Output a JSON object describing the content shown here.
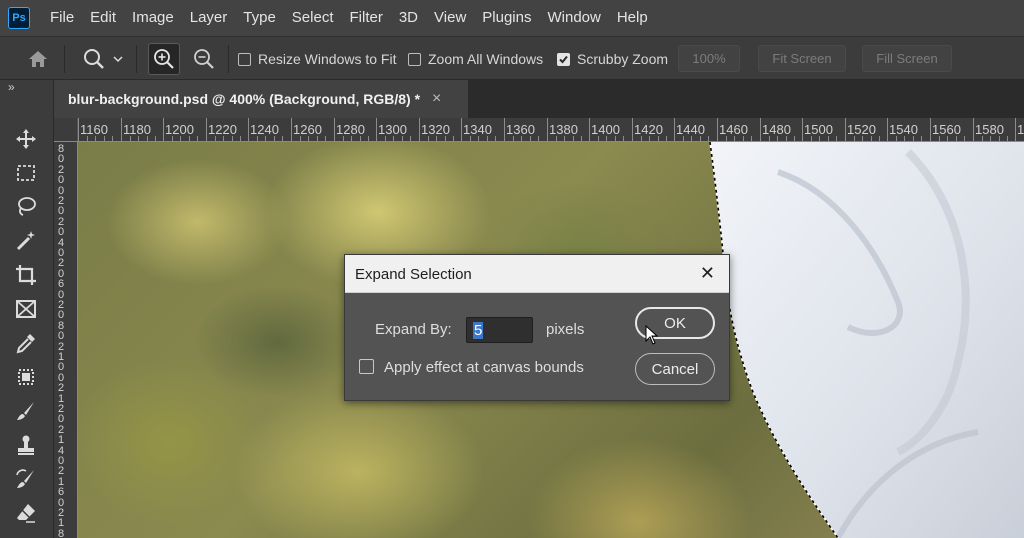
{
  "app": {
    "logo": "Ps"
  },
  "menu": [
    "File",
    "Edit",
    "Image",
    "Layer",
    "Type",
    "Select",
    "Filter",
    "3D",
    "View",
    "Plugins",
    "Window",
    "Help"
  ],
  "options": {
    "resize_windows_label": "Resize Windows to Fit",
    "zoom_all_label": "Zoom All Windows",
    "scrubby_zoom_label": "Scrubby Zoom",
    "zoom_percent": "100%",
    "fit_screen": "Fit Screen",
    "fill_screen": "Fill Screen",
    "resize_windows_checked": false,
    "zoom_all_checked": false,
    "scrubby_zoom_checked": true
  },
  "toolbar": {
    "collapse": "»"
  },
  "document": {
    "tab_title": "blur-background.psd @ 400% (Background, RGB/8) *",
    "close": "×"
  },
  "ruler": {
    "top_labels": [
      "1160",
      "1180",
      "1200",
      "1220",
      "1240",
      "1260",
      "1280",
      "1300",
      "1320",
      "1340",
      "1360",
      "1380",
      "1400",
      "1420",
      "1440",
      "1460",
      "1480",
      "1500",
      "1520",
      "1540",
      "1560",
      "1580",
      "1"
    ],
    "left_digits": [
      "8",
      "0",
      "2",
      "0",
      "0",
      "2",
      "0",
      "2",
      "0",
      "4",
      "0",
      "2",
      "0",
      "6",
      "0",
      "2",
      "0",
      "8",
      "0",
      "2",
      "1",
      "0",
      "0",
      "2",
      "1",
      "2",
      "0",
      "2",
      "1",
      "4",
      "0",
      "2",
      "1",
      "6",
      "0",
      "2",
      "1",
      "8"
    ]
  },
  "dialog": {
    "title": "Expand Selection",
    "close": "✕",
    "expand_by_label": "Expand By:",
    "expand_by_value": "5",
    "units": "pixels",
    "checkbox_label": "Apply effect at canvas bounds",
    "ok": "OK",
    "cancel": "Cancel"
  },
  "colors": {
    "accent": "#31a8ff",
    "selection": "#3d77c9"
  }
}
